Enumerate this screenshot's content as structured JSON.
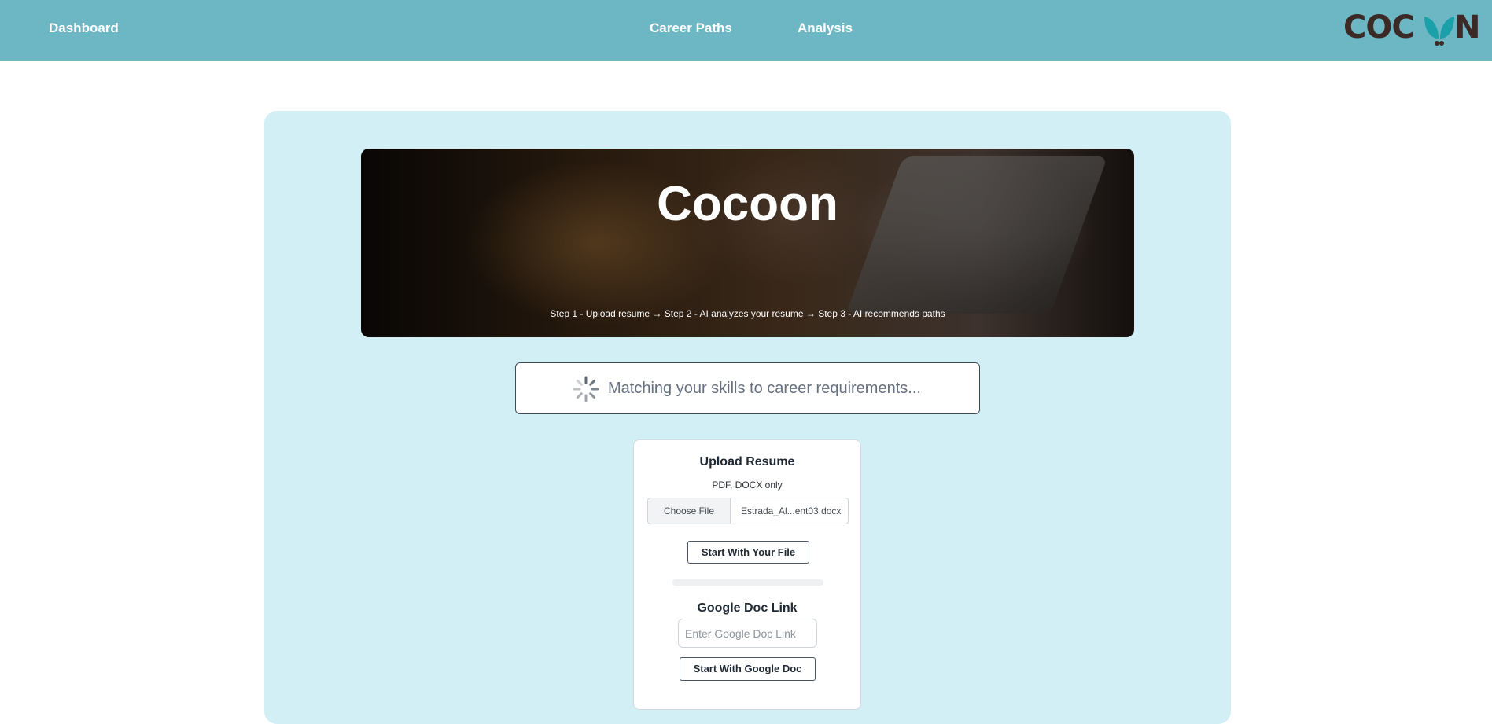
{
  "nav": {
    "dashboard": "Dashboard",
    "career_paths": "Career Paths",
    "analysis": "Analysis"
  },
  "logo": {
    "text_left": "COC",
    "text_right": "N",
    "primary_color": "#3b2a25",
    "accent_color": "#1aa0a8"
  },
  "hero": {
    "title": "Cocoon",
    "steps": "Step 1 - Upload resume → Step 2 - AI analyzes your resume → Step 3 - AI recommends paths"
  },
  "status": {
    "icon": "spinner-icon",
    "text": "Matching your skills to career requirements..."
  },
  "upload": {
    "title": "Upload Resume",
    "subtitle": "PDF, DOCX only",
    "choose_label": "Choose File",
    "file_name": "Estrada_Al...ent03.docx",
    "start_file_label": "Start With Your File",
    "progress": 0
  },
  "gdoc": {
    "title": "Google Doc Link",
    "placeholder": "Enter Google Doc Link",
    "value": "",
    "start_label": "Start With Google Doc"
  },
  "colors": {
    "topbar": "#6db7c5",
    "panel": "#d1eff4"
  }
}
